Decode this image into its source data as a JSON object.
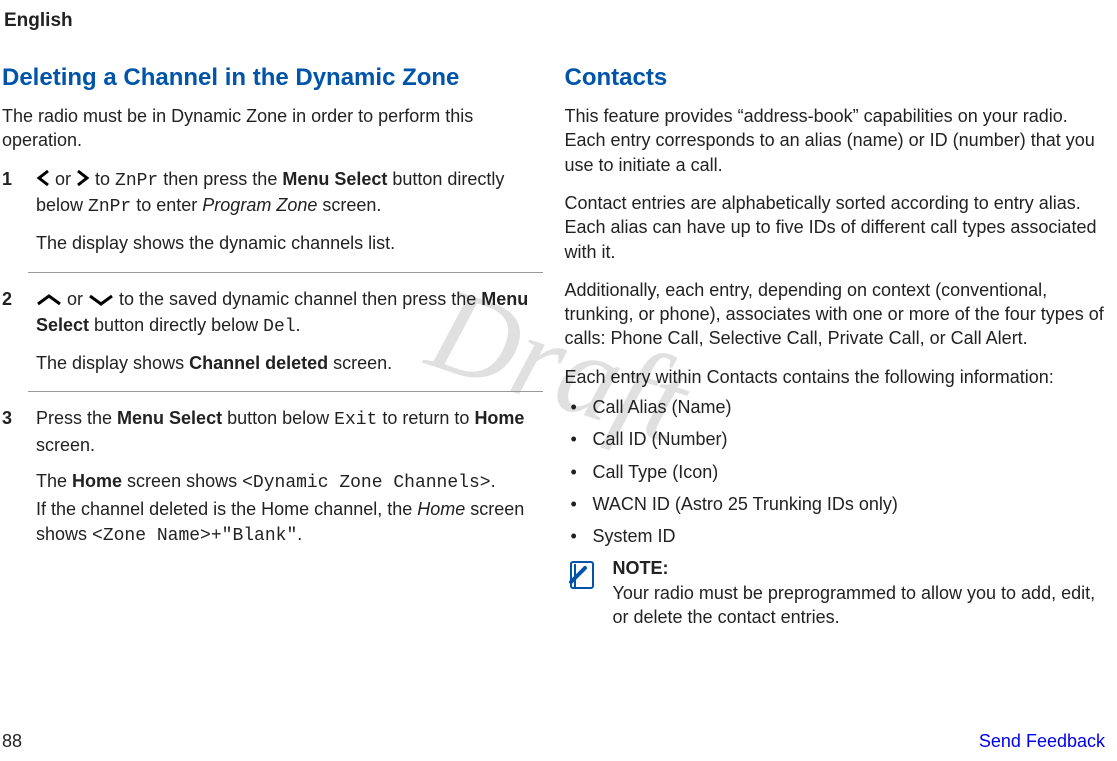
{
  "header": {
    "language": "English"
  },
  "watermark": "Draft",
  "left": {
    "heading": "Deleting a Channel in the Dynamic Zone",
    "intro": "The radio must be in Dynamic Zone in order to perform this operation.",
    "steps": [
      {
        "num": "1",
        "p1_a": " or ",
        "p1_b": " to ",
        "p1_zn": "ZnPr",
        "p1_c": " then press the ",
        "p1_menu": "Menu Select",
        "p1_d": " button directly below ",
        "p1_zn2": "ZnPr",
        "p1_e": " to enter ",
        "p1_pz": "Program Zone",
        "p1_f": " screen.",
        "p2": "The display shows the dynamic channels list."
      },
      {
        "num": "2",
        "p1_a": " or ",
        "p1_b": " to the saved dynamic channel then press the ",
        "p1_menu": "Menu Select",
        "p1_c": " button directly below ",
        "p1_del": "Del",
        "p1_d": ".",
        "p2_a": "The display shows ",
        "p2_b": "Channel deleted",
        "p2_c": " screen."
      },
      {
        "num": "3",
        "p1_a": "Press the ",
        "p1_menu": "Menu Select",
        "p1_b": " button below ",
        "p1_exit": "Exit",
        "p1_c": " to return to ",
        "p1_home": "Home",
        "p1_d": " screen.",
        "p2_a": "The ",
        "p2_home": "Home",
        "p2_b": " screen shows ",
        "p2_dzc": "<Dynamic Zone Channels>",
        "p2_c": ".",
        "p3_a": "If the channel deleted is the Home channel, the ",
        "p3_home": "Home",
        "p3_b": " screen shows ",
        "p3_zone": "<Zone Name>+\"Blank\"",
        "p3_c": "."
      }
    ]
  },
  "right": {
    "heading": "Contacts",
    "p1": "This feature provides “address-book” capabilities on your radio. Each entry corresponds to an alias (name) or ID (number) that you use to initiate a call.",
    "p2": "Contact entries are alphabetically sorted according to entry alias. Each alias can have up to five IDs of different call types associated with it.",
    "p3": "Additionally, each entry, depending on context (conventional, trunking, or phone), associates with one or more of the four types of calls: Phone Call, Selective Call, Private Call, or Call Alert.",
    "p4": "Each entry within Contacts contains the following information:",
    "bullets": [
      "Call Alias (Name)",
      "Call ID (Number)",
      "Call Type (Icon)",
      "WACN ID (Astro 25 Trunking IDs only)",
      "System ID"
    ],
    "note_title": "NOTE:",
    "note_body": "Your radio must be preprogrammed to allow you to add, edit, or delete the contact entries."
  },
  "footer": {
    "page": "88",
    "feedback": "Send Feedback"
  }
}
